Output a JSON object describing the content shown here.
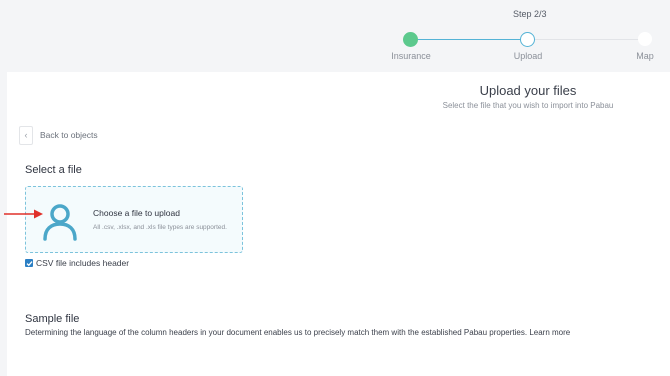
{
  "stepper": {
    "counter": "Step 2/3",
    "steps": [
      {
        "label": "Insurance",
        "state": "completed"
      },
      {
        "label": "Upload",
        "state": "current"
      },
      {
        "label": "Map",
        "state": "upcoming"
      }
    ]
  },
  "header": {
    "title": "Upload your files",
    "subtitle": "Select the file that you wish to import into Pabau"
  },
  "back": {
    "icon": "chevron-left-icon",
    "label": "Back to objects"
  },
  "select_file": {
    "title": "Select a file",
    "dropzone": {
      "icon": "user-icon",
      "title": "Choose a file to upload",
      "subtitle": "All .csv, .xlsx, and .xls file types are supported."
    },
    "checkbox": {
      "label": "CSV file includes header",
      "checked": true
    }
  },
  "sample": {
    "title": "Sample file",
    "description": "Determining the language of the column headers in your document enables us to precisely match them with the established Pabau properties.",
    "learn_more": "Learn more"
  },
  "colors": {
    "completed": "#5cc98d",
    "current": "#54b3d6",
    "accent_icon": "#4ba7c9",
    "arrow": "#e0302a",
    "checkbox": "#2b7fc4"
  }
}
